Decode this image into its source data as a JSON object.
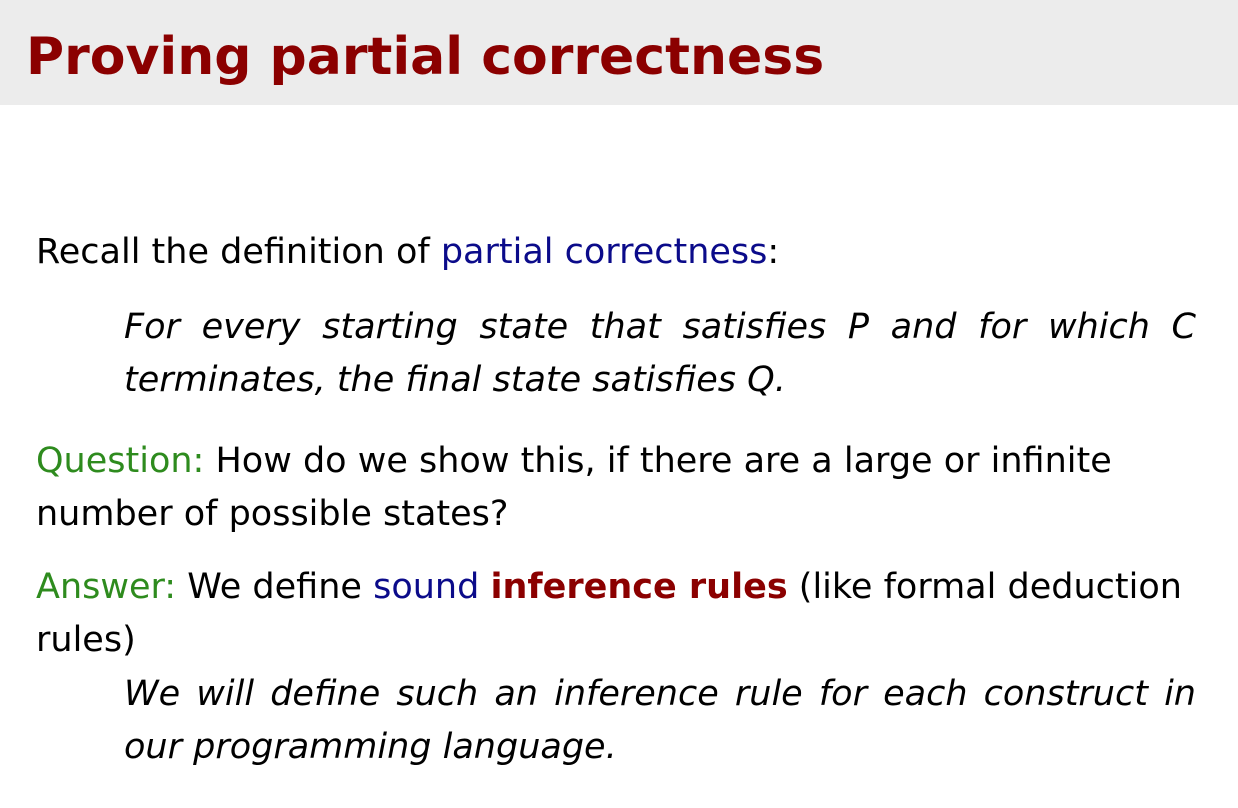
{
  "slide": {
    "title": "Proving partial correctness",
    "recall": {
      "prefix": "Recall the definition of ",
      "term": "partial correctness",
      "suffix": ":"
    },
    "definition_quote": "For every starting state that satisfies P and for which C terminates, the final state satisfies Q.",
    "question": {
      "label": "Question:",
      "text": " How do we show this, if there are a large or infinite number of possible states?"
    },
    "answer": {
      "label": "Answer:",
      "before": " We define ",
      "sound": "sound",
      "space": " ",
      "inference_rules": "inference rules",
      "after": " (like formal deduction rules)"
    },
    "answer_note": "We will define such an inference rule for each construct in our programming language."
  },
  "colors": {
    "title": "#8b0000",
    "title_bar": "#ececec",
    "term_blue": "#0b0b8a",
    "label_green": "#2e8b1e",
    "emphasis_red": "#8b0000"
  }
}
